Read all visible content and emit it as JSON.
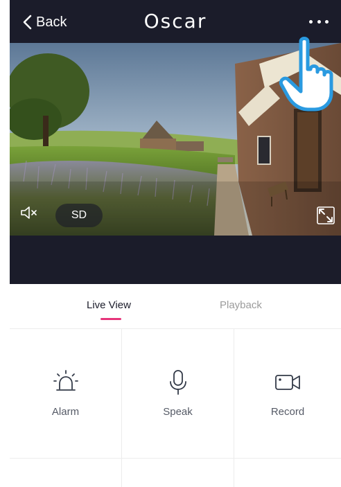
{
  "header": {
    "back_label": "Back",
    "title": "Oscar"
  },
  "video": {
    "quality_label": "SD"
  },
  "tabs": [
    {
      "label": "Live View",
      "active": true
    },
    {
      "label": "Playback",
      "active": false
    }
  ],
  "actions": [
    {
      "label": "Alarm",
      "icon": "alarm-icon"
    },
    {
      "label": "Speak",
      "icon": "microphone-icon"
    },
    {
      "label": "Record",
      "icon": "video-camera-icon"
    }
  ],
  "colors": {
    "header_bg": "#1b1c2a",
    "accent": "#e6357a",
    "hand_blue": "#2a9ae0"
  }
}
